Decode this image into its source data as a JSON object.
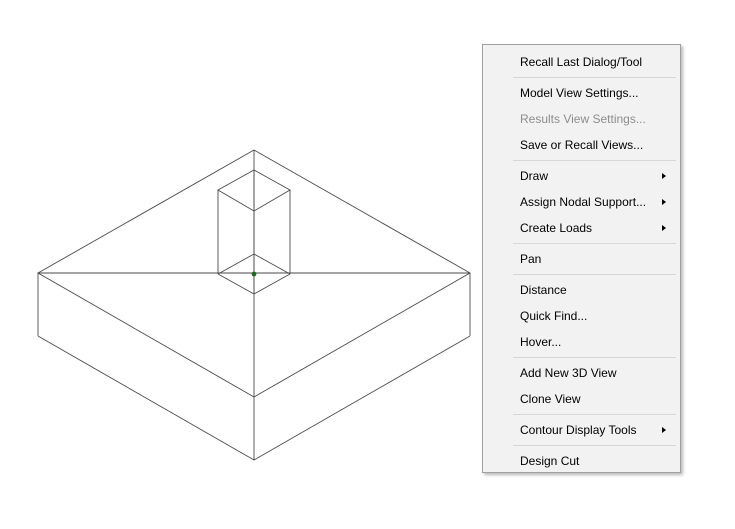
{
  "viewport": {
    "node_color": "#1a6b1a"
  },
  "context_menu": {
    "groups": [
      [
        {
          "label": "Recall Last Dialog/Tool",
          "enabled": true,
          "submenu": false
        }
      ],
      [
        {
          "label": "Model View Settings...",
          "enabled": true,
          "submenu": false
        },
        {
          "label": "Results View Settings...",
          "enabled": false,
          "submenu": false
        },
        {
          "label": "Save or Recall Views...",
          "enabled": true,
          "submenu": false
        }
      ],
      [
        {
          "label": "Draw",
          "enabled": true,
          "submenu": true
        },
        {
          "label": "Assign Nodal Support...",
          "enabled": true,
          "submenu": true
        },
        {
          "label": "Create Loads",
          "enabled": true,
          "submenu": true
        }
      ],
      [
        {
          "label": "Pan",
          "enabled": true,
          "submenu": false
        }
      ],
      [
        {
          "label": "Distance",
          "enabled": true,
          "submenu": false
        },
        {
          "label": "Quick Find...",
          "enabled": true,
          "submenu": false
        },
        {
          "label": "Hover...",
          "enabled": true,
          "submenu": false
        }
      ],
      [
        {
          "label": "Add New 3D View",
          "enabled": true,
          "submenu": false
        },
        {
          "label": "Clone View",
          "enabled": true,
          "submenu": false
        }
      ],
      [
        {
          "label": "Contour Display Tools",
          "enabled": true,
          "submenu": true
        }
      ],
      [
        {
          "label": "Design Cut",
          "enabled": true,
          "submenu": false
        }
      ]
    ]
  }
}
